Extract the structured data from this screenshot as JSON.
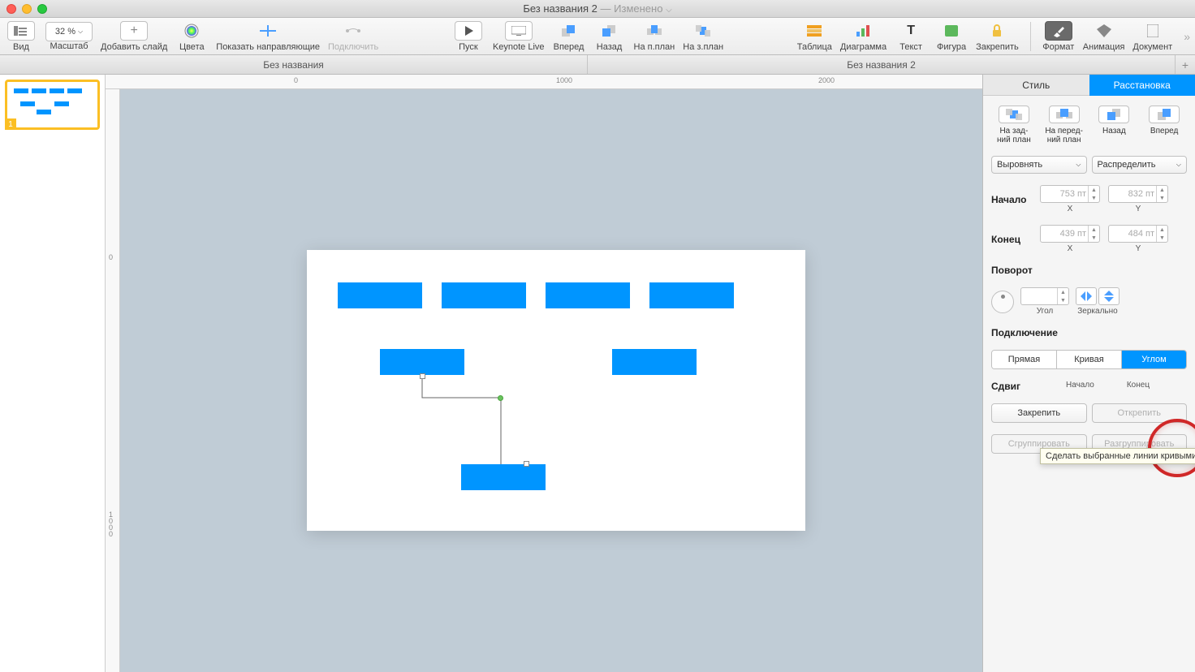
{
  "title": {
    "name": "Без названия 2",
    "modified": "— Изменено"
  },
  "toolbar": {
    "view": "Вид",
    "zoom_label": "Масштаб",
    "zoom_value": "32 %",
    "add_slide": "Добавить слайд",
    "colors": "Цвета",
    "guides": "Показать направляющие",
    "connect": "Подключить",
    "play": "Пуск",
    "live": "Keynote Live",
    "forward": "Вперед",
    "back": "Назад",
    "front": "На п.план",
    "behind": "На з.план",
    "table": "Таблица",
    "chart": "Диаграмма",
    "text": "Текст",
    "shape": "Фигура",
    "lock": "Закрепить",
    "format": "Формат",
    "animation": "Анимация",
    "document": "Документ"
  },
  "subtabs": {
    "left": "Без названия",
    "right": "Без названия 2"
  },
  "ruler": {
    "h_0": "0",
    "h_1000": "1000",
    "h_2000": "2000",
    "v_0": "0",
    "v_1000": "1\n0\n0\n0"
  },
  "inspector": {
    "tab_style": "Стиль",
    "tab_arrange": "Расстановка",
    "back_layer": "На зад-\nний план",
    "front_layer": "На перед-\nний план",
    "backward": "Назад",
    "forward": "Вперед",
    "align": "Выровнять",
    "distribute": "Распределить",
    "start": "Начало",
    "end": "Конец",
    "start_x": "753 пт",
    "start_y": "832 пт",
    "end_x": "439 пт",
    "end_y": "484 пт",
    "x": "X",
    "y": "Y",
    "rotation": "Поворот",
    "angle": "Угол",
    "mirror": "Зеркально",
    "connection": "Подключение",
    "straight": "Прямая",
    "curve": "Кривая",
    "angled": "Углом",
    "tooltip": "Сделать выбранные линии кривыми",
    "offset": "Сдвиг",
    "offset_start": "Начало",
    "offset_end": "Конец",
    "lock": "Закрепить",
    "unlock": "Открепить",
    "group": "Сгруппировать",
    "ungroup": "Разгруппировать"
  },
  "slide_number": "1"
}
